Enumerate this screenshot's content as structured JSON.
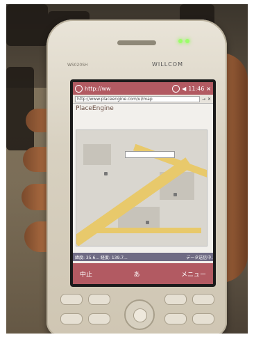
{
  "phone": {
    "brand": "WILLCOM",
    "model": "WS020SH"
  },
  "browser": {
    "title": "http://ww",
    "clock": "11:46",
    "close": "×",
    "url": "http://www.placeengine.com/ui/map",
    "logo": "PlaceEngine"
  },
  "status": {
    "left": "緯度: 35.6... 経度: 139.7...",
    "right": "データ送信中..."
  },
  "softkeys": {
    "left": "中止",
    "center": "あ",
    "right": "メニュー"
  }
}
